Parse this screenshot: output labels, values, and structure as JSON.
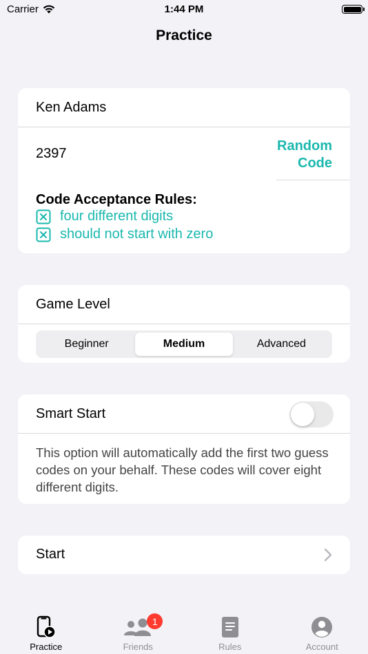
{
  "status_bar": {
    "carrier": "Carrier",
    "time": "1:44 PM"
  },
  "nav": {
    "title": "Practice"
  },
  "player": {
    "name": "Ken Adams",
    "code": "2397",
    "random_code_label": "Random\nCode",
    "rules_heading": "Code Acceptance Rules:",
    "rules": [
      "four different digits",
      "should not start with zero"
    ]
  },
  "game_level": {
    "label": "Game Level",
    "options": [
      "Beginner",
      "Medium",
      "Advanced"
    ],
    "selected": "Medium"
  },
  "smart_start": {
    "label": "Smart Start",
    "enabled": false,
    "description": "This option will automatically add the first two guess codes on your behalf. These codes will cover eight different digits."
  },
  "start": {
    "label": "Start"
  },
  "tabs": [
    {
      "label": "Practice",
      "icon": "phone-play-icon",
      "active": true
    },
    {
      "label": "Friends",
      "icon": "people-icon",
      "badge": "1"
    },
    {
      "label": "Rules",
      "icon": "document-icon"
    },
    {
      "label": "Account",
      "icon": "person-circle-icon"
    }
  ],
  "colors": {
    "accent": "#1ab8ae",
    "background": "#f2f2f7",
    "badge": "#ff3b30"
  }
}
